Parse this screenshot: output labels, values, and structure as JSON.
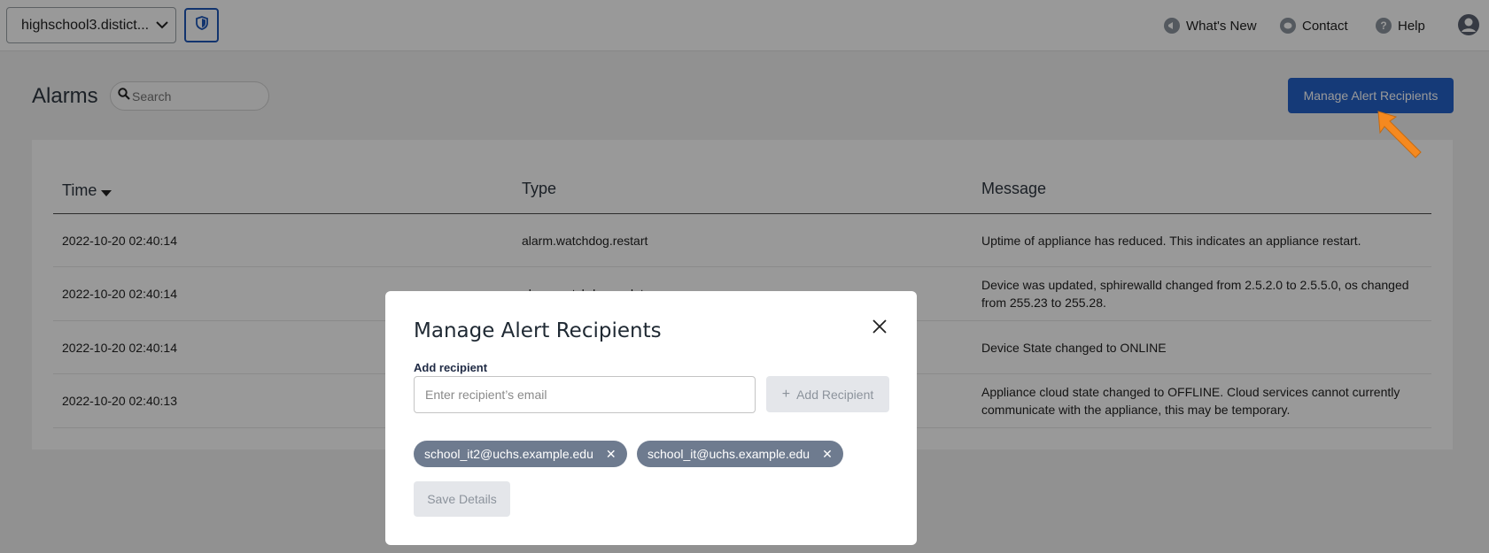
{
  "header": {
    "org_select": "highschool3.distict...",
    "links": {
      "whats_new": "What's New",
      "contact": "Contact",
      "help": "Help"
    }
  },
  "page": {
    "title": "Alarms",
    "search_placeholder": "Search",
    "manage_button": "Manage Alert Recipients"
  },
  "table": {
    "columns": [
      "Time",
      "Type",
      "Message"
    ],
    "rows": [
      {
        "time": "2022-10-20 02:40:14",
        "type": "alarm.watchdog.restart",
        "message": "Uptime of appliance has reduced. This indicates an appliance restart."
      },
      {
        "time": "2022-10-20 02:40:14",
        "type": "alarm.watchdog.update",
        "message": "Device was updated, sphirewalld changed from 2.5.2.0 to 2.5.5.0, os changed from 255.23 to 255.28."
      },
      {
        "time": "2022-10-20 02:40:14",
        "type": "",
        "message": "Device State changed to ONLINE"
      },
      {
        "time": "2022-10-20 02:40:13",
        "type": "",
        "message": "Appliance cloud state changed to OFFLINE. Cloud services cannot currently communicate with the appliance, this may be temporary."
      }
    ]
  },
  "modal": {
    "title": "Manage Alert Recipients",
    "field_label": "Add recipient",
    "email_placeholder": "Enter recipient’s email",
    "add_button": "Add Recipient",
    "recipients": [
      "school_it2@uchs.example.edu",
      "school_it@uchs.example.edu"
    ],
    "save_button": "Save Details"
  },
  "colors": {
    "primary": "#2461c9",
    "chip": "#6e7b8f",
    "annotation_arrow": "#f5891f"
  }
}
